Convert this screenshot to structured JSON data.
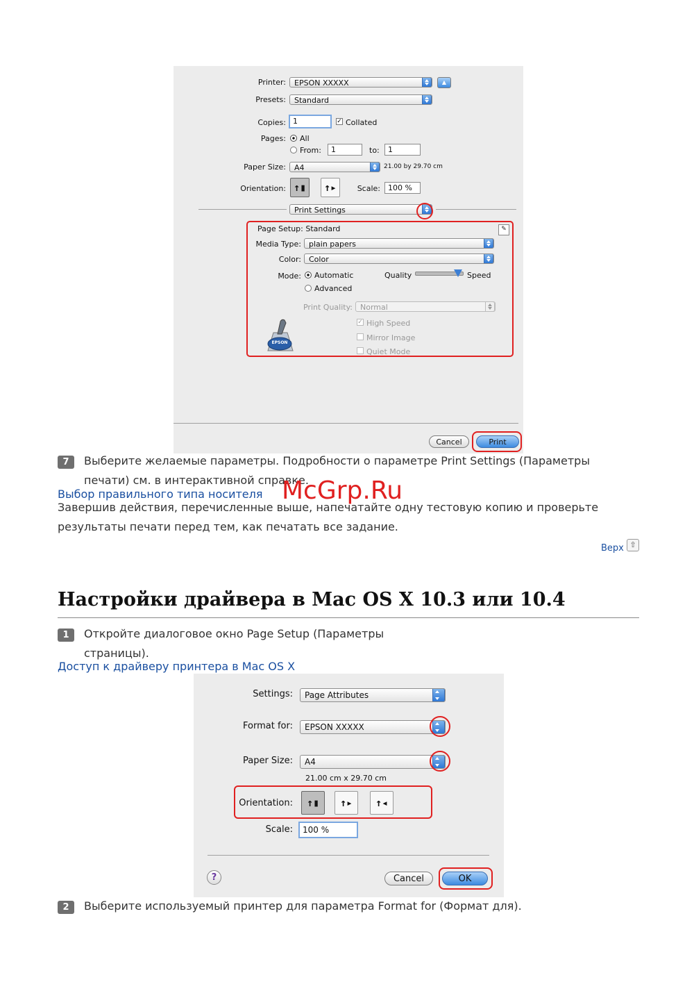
{
  "dialog1": {
    "printer_label": "Printer:",
    "printer_value": "EPSON XXXXX",
    "presets_label": "Presets:",
    "presets_value": "Standard",
    "copies_label": "Copies:",
    "copies_value": "1",
    "collated_label": "Collated",
    "pages_label": "Pages:",
    "all_label": "All",
    "from_label": "From:",
    "from_value": "1",
    "to_label": "to:",
    "to_value": "1",
    "paper_size_label": "Paper Size:",
    "paper_size_value": "A4",
    "paper_size_dims": "21.00 by 29.70 cm",
    "orientation_label": "Orientation:",
    "scale_label": "Scale:",
    "scale_value": "100 %",
    "panel_value": "Print Settings",
    "page_setup_text": "Page Setup: Standard",
    "media_type_label": "Media Type:",
    "media_type_value": "plain papers",
    "color_label": "Color:",
    "color_value": "Color",
    "mode_label": "Mode:",
    "automatic_label": "Automatic",
    "advanced_label": "Advanced",
    "quality_label": "Quality",
    "speed_label": "Speed",
    "print_quality_label": "Print Quality:",
    "print_quality_value": "Normal",
    "high_speed_label": "High Speed",
    "mirror_image_label": "Mirror Image",
    "quiet_mode_label": "Quiet Mode",
    "epson_logo": "EPSON",
    "cancel_label": "Cancel",
    "print_label": "Print"
  },
  "step7": {
    "num": "7",
    "line1": "Выберите желаемые параметры. Подробности о параметре Print Settings (Параметры",
    "line2": "печати) см. в интерактивной справке."
  },
  "link_media": "Выбор правильного типа носителя",
  "watermark": "McGrp.Ru",
  "para_finish_1": "Завершив действия, перечисленные выше, напечатайте одну тестовую копию и проверьте",
  "para_finish_2": "результаты печати перед тем, как печатать все задание.",
  "top_link": "Верх",
  "section_heading": "Настройки драйвера в Mac OS X 10.3 или 10.4",
  "step1": {
    "num": "1",
    "line1": "Откройте диалоговое окно Page Setup (Параметры",
    "line2": "страницы)."
  },
  "link_driver": "Доступ к драйверу принтера в Mac OS X",
  "dialog2": {
    "settings_label": "Settings:",
    "settings_value": "Page Attributes",
    "format_label": "Format for:",
    "format_value": "EPSON XXXXX",
    "paper_size_label": "Paper Size:",
    "paper_size_value": "A4",
    "paper_size_dims": "21.00 cm x 29.70 cm",
    "orientation_label": "Orientation:",
    "scale_label": "Scale:",
    "scale_value": "100 %",
    "help_label": "?",
    "cancel_label": "Cancel",
    "ok_label": "OK"
  },
  "step2": {
    "num": "2",
    "line1": "Выберите используемый принтер для параметра Format for (Формат для)."
  }
}
